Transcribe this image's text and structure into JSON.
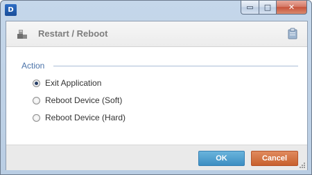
{
  "window": {
    "app_icon_text": "D",
    "minimize_glyph": "▭",
    "maximize_glyph": "□",
    "close_glyph": "✕"
  },
  "header": {
    "title": "Restart / Reboot",
    "icon": "restart-device-icon",
    "help_icon": "clipboard-icon"
  },
  "action_group": {
    "label": "Action",
    "options": [
      {
        "label": "Exit Application",
        "selected": true
      },
      {
        "label": "Reboot Device (Soft)",
        "selected": false
      },
      {
        "label": "Reboot Device (Hard)",
        "selected": false
      }
    ]
  },
  "footer": {
    "ok_label": "OK",
    "cancel_label": "Cancel"
  },
  "colors": {
    "ok_button": "#4a9ccd",
    "cancel_button": "#d06e3d",
    "section_label": "#4a72a8"
  }
}
